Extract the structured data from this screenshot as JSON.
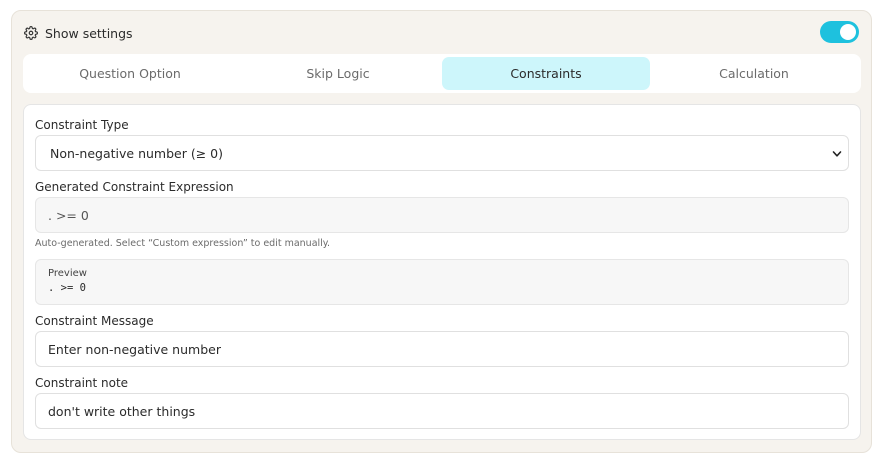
{
  "header": {
    "title": "Show settings",
    "icon": "gear-icon",
    "toggle_on": true,
    "accent_color": "#1ec1de"
  },
  "tabs": [
    {
      "label": "Question Option",
      "active": false
    },
    {
      "label": "Skip Logic",
      "active": false
    },
    {
      "label": "Constraints",
      "active": true
    },
    {
      "label": "Calculation",
      "active": false
    }
  ],
  "constraints": {
    "type_label": "Constraint Type",
    "type_value": "Non-negative number (≥ 0)",
    "expression_label": "Generated Constraint Expression",
    "expression_value": ". >= 0",
    "expression_hint": "Auto-generated. Select “Custom expression” to edit manually.",
    "preview_label": "Preview",
    "preview_value": ". >= 0",
    "message_label": "Constraint Message",
    "message_value": "Enter non-negative number",
    "note_label": "Constraint note",
    "note_value": "don't write other things"
  }
}
